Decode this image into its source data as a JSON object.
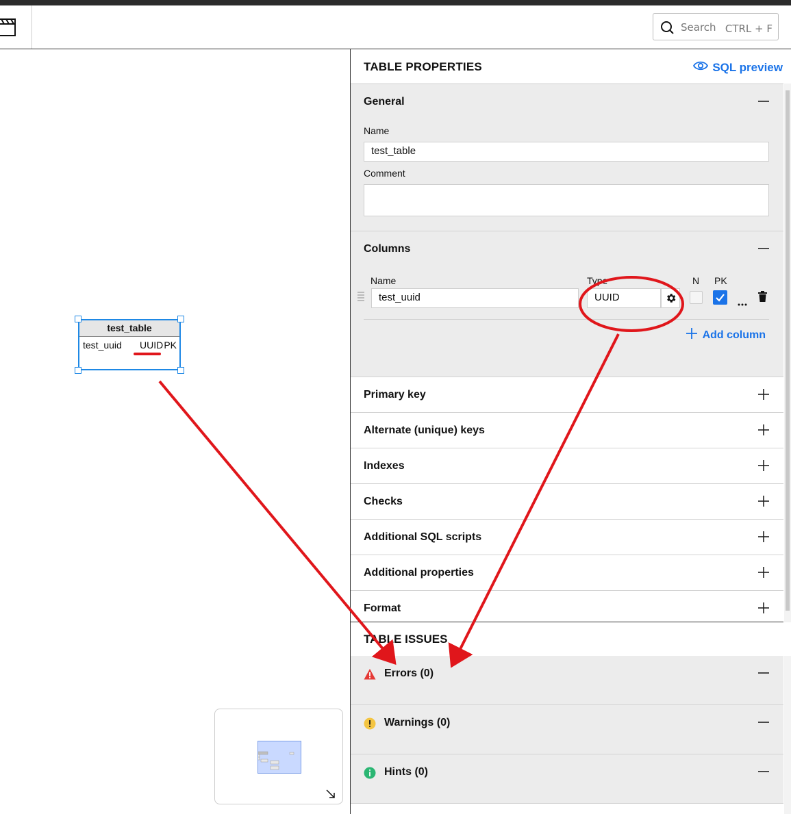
{
  "toolbar": {
    "search_placeholder": "Search",
    "search_shortcut": "CTRL + F"
  },
  "diagram": {
    "entity": {
      "name": "test_table",
      "column_name": "test_uuid",
      "column_type": "UUID",
      "column_flag": "PK"
    }
  },
  "panel": {
    "title": "TABLE PROPERTIES",
    "sql_preview_label": "SQL preview",
    "general": {
      "label": "General",
      "name_label": "Name",
      "name_value": "test_table",
      "comment_label": "Comment",
      "comment_value": ""
    },
    "columns": {
      "label": "Columns",
      "header_name": "Name",
      "header_type": "Type",
      "header_n": "N",
      "header_pk": "PK",
      "rows": [
        {
          "name": "test_uuid",
          "type": "UUID",
          "nullable": false,
          "pk": true
        }
      ],
      "add_label": "Add column"
    },
    "sections": [
      {
        "label": "Primary key"
      },
      {
        "label": "Alternate (unique) keys"
      },
      {
        "label": "Indexes"
      },
      {
        "label": "Checks"
      },
      {
        "label": "Additional SQL scripts"
      },
      {
        "label": "Additional properties"
      },
      {
        "label": "Format"
      }
    ]
  },
  "issues": {
    "title": "TABLE ISSUES",
    "errors_label": "Errors (0)",
    "warnings_label": "Warnings (0)",
    "hints_label": "Hints (0)"
  },
  "colors": {
    "accent": "#1a73e8",
    "selection": "#1e88e5",
    "annotation": "#e0161b",
    "error": "#e53935",
    "warning": "#f4c542",
    "hint": "#2bb673"
  }
}
